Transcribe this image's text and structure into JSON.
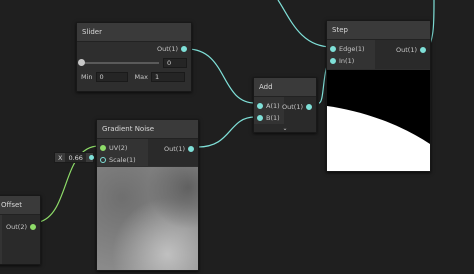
{
  "nodes": {
    "slider": {
      "title": "Slider",
      "out_label": "Out(1)",
      "value": "0",
      "min_label": "Min",
      "min_value": "0",
      "max_label": "Max",
      "max_value": "1",
      "handle_fraction": 0
    },
    "add": {
      "title": "Add",
      "in_a": "A(1)",
      "in_b": "B(1)",
      "out_label": "Out(1)",
      "expand": "⌄"
    },
    "step": {
      "title": "Step",
      "in_edge": "Edge(1)",
      "in_in": "In(1)",
      "out_label": "Out(1)"
    },
    "noise": {
      "title": "Gradient Noise",
      "in_uv": "UV(2)",
      "in_scale": "Scale(1)",
      "out_label": "Out(1)"
    },
    "offset": {
      "title": "Offset",
      "out_label": "Out(2)"
    }
  },
  "scale_input": {
    "axis": "X",
    "value": "0.66"
  },
  "colors": {
    "wire": "#7fe0d8",
    "port": "#7fe0d8",
    "uv_port": "#8edc69",
    "background": "#1f1f1f"
  }
}
